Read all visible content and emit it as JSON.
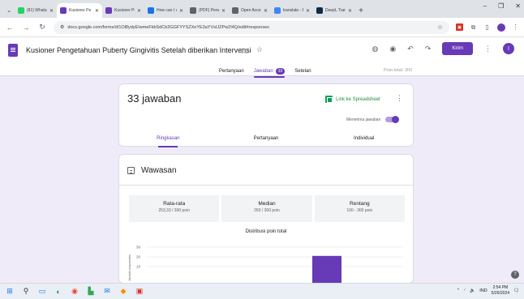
{
  "browser": {
    "tabs": [
      {
        "label": "(81) WhatsA",
        "color": "#25d366"
      },
      {
        "label": "Kusioner Pe",
        "color": "#673ab7",
        "active": true
      },
      {
        "label": "Kusioner Pe",
        "color": "#673ab7"
      },
      {
        "label": "How can I u",
        "color": "#1a73e8"
      },
      {
        "label": "(PDF) Penelit",
        "color": "#5f6368"
      },
      {
        "label": "Open Acces",
        "color": "#5f6368"
      },
      {
        "label": "translate - P",
        "color": "#4285f4"
      },
      {
        "label": "DeepL Trans",
        "color": "#0f2b46"
      }
    ],
    "url": "docs.google.com/forms/d/1Ol8ydyEIwmeFkbSdCb3GGFYYSZXeYE3aYVsIJZPw2I4Q/edit#responses"
  },
  "form": {
    "title": "Kusioner Pengetahuan Puberty Gingivitis Setelah diberikan Intervensi",
    "send_label": "Kirim",
    "avatar_letter": "I",
    "tabs": {
      "questions": "Pertanyaan",
      "responses": "Jawaban",
      "responses_count": "33",
      "settings": "Setelan"
    },
    "total_points": "Poin total: 300"
  },
  "summary": {
    "responses_label": "33 jawaban",
    "sheet_link": "Link ke Spreadsheet",
    "accepting_label": "Menerima jawaban",
    "subtabs": [
      "Ringkasan",
      "Pertanyaan",
      "Individual"
    ]
  },
  "insights": {
    "heading": "Wawasan",
    "stats": [
      {
        "label": "Rata-rata",
        "value": "253,33 / 300 poin"
      },
      {
        "label": "Median",
        "value": "260 / 300 poin"
      },
      {
        "label": "Rentang",
        "value": "100 - 300 poin"
      }
    ],
    "chart_title": "Distribusi poin total"
  },
  "chart_data": {
    "type": "bar",
    "title": "Distribusi poin total",
    "ylabel": "Jumlah responden",
    "yticks": [
      10,
      20,
      30
    ],
    "visible_bar_value": 21
  },
  "taskbar": {
    "lang": "IND",
    "time": "2:54 PM",
    "date": "5/26/2024"
  }
}
